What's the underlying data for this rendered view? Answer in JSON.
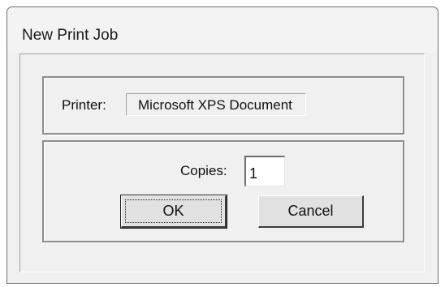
{
  "window": {
    "title": "New Print Job"
  },
  "printer_group": {
    "label": "Printer:",
    "value": "Microsoft XPS Document"
  },
  "copies_group": {
    "label": "Copies:",
    "value": "1",
    "ok_label": "OK",
    "cancel_label": "Cancel"
  }
}
